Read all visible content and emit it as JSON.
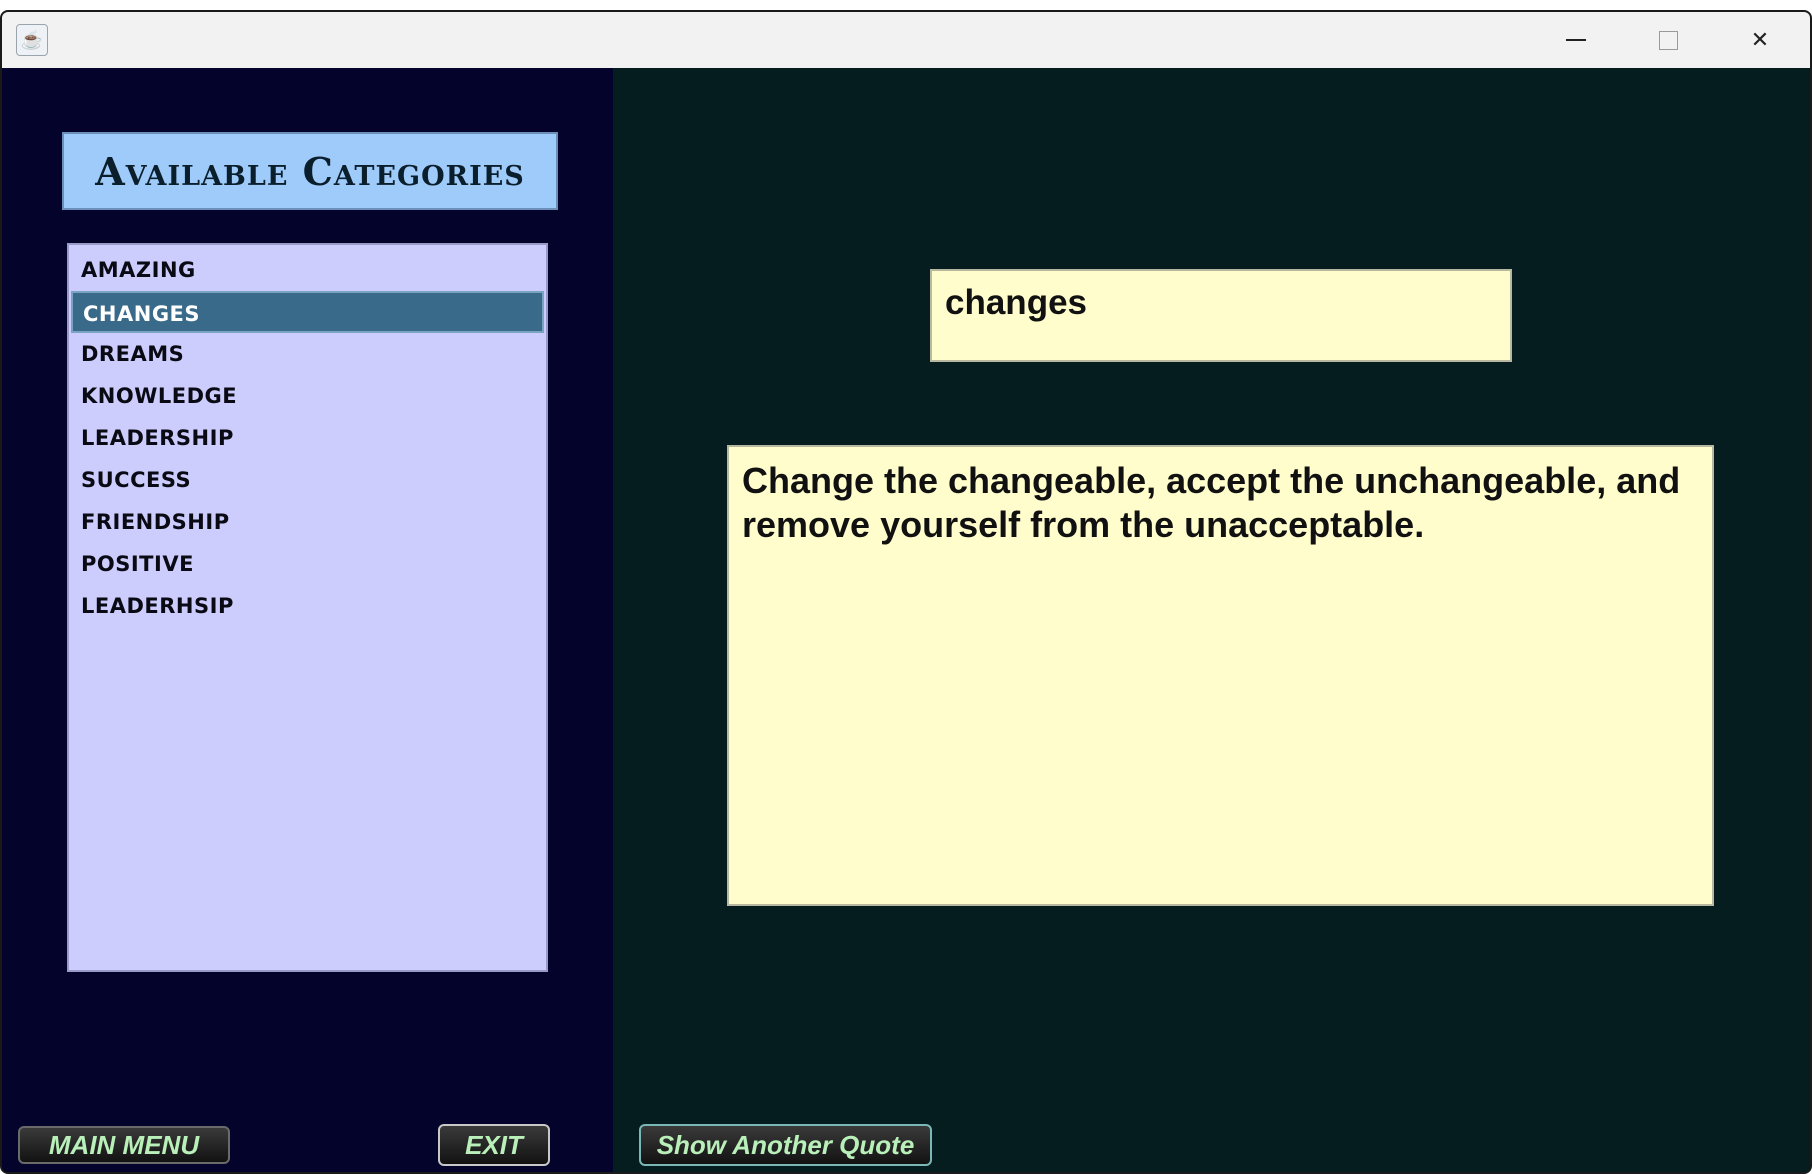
{
  "titlebar": {
    "app_icon": "java-icon",
    "minimize_icon": "minimize-icon",
    "maximize_icon": "maximize-icon",
    "close_icon": "close-icon",
    "close_glyph": "✕"
  },
  "sidebar": {
    "header": "Available Categories",
    "categories": [
      {
        "label": "AMAZING",
        "selected": false
      },
      {
        "label": "CHANGES",
        "selected": true
      },
      {
        "label": "DREAMS",
        "selected": false
      },
      {
        "label": "KNOWLEDGE",
        "selected": false
      },
      {
        "label": "LEADERSHIP",
        "selected": false
      },
      {
        "label": "SUCCESS",
        "selected": false
      },
      {
        "label": "FRIENDSHIP",
        "selected": false
      },
      {
        "label": "POSITIVE",
        "selected": false
      },
      {
        "label": "LEADERHSIP",
        "selected": false
      }
    ]
  },
  "main": {
    "category_value": "changes",
    "quote_text": "Change the changeable, accept the unchangeable, and remove yourself from the unacceptable."
  },
  "buttons": {
    "main_menu": "MAIN MENU",
    "exit": "EXIT",
    "show_another": "Show Another Quote"
  },
  "colors": {
    "left_bg": "#03032c",
    "right_bg": "#051d1f",
    "list_bg": "#ccccfd",
    "selected_bg": "#3a6a8a",
    "text_box_bg": "#fffdcc",
    "header_bg": "#9ecbfa",
    "button_text": "#b9f0b9"
  }
}
